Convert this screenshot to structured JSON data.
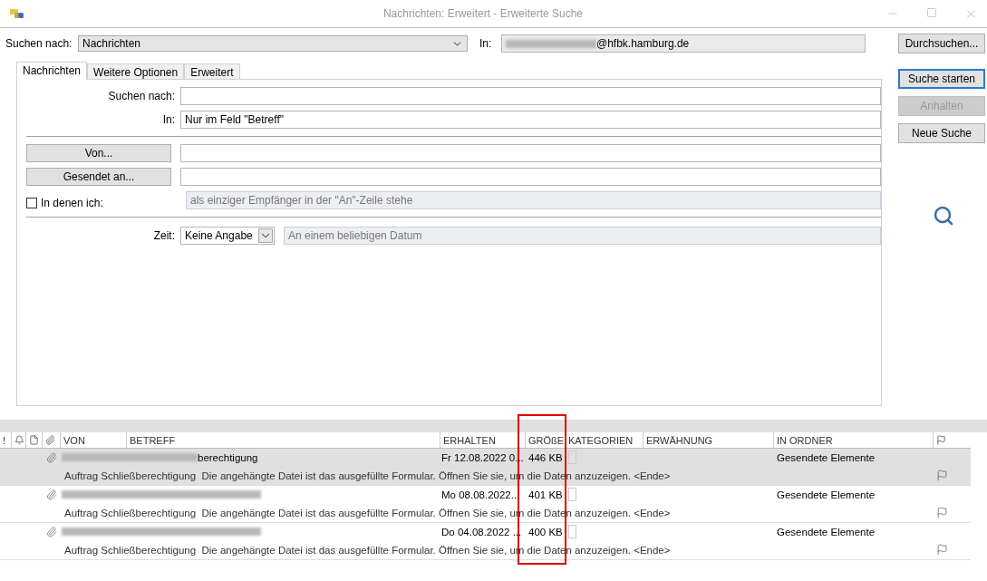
{
  "window": {
    "title": "Nachrichten: Erweitert - Erweiterte Suche"
  },
  "search_for": {
    "label": "Suchen nach:",
    "value": "Nachrichten"
  },
  "location": {
    "label": "In:",
    "value": "@hfbk.hamburg.de"
  },
  "tabs": [
    {
      "label": "Nachrichten",
      "selected": true
    },
    {
      "label": "Weitere Optionen",
      "selected": false
    },
    {
      "label": "Erweitert",
      "selected": false
    }
  ],
  "form": [
    {
      "kind": "text",
      "label": "Suchen nach:"
    },
    {
      "kind": "text",
      "label": "In:",
      "value": "Nur im Feld \"Betreff\""
    },
    {
      "kind": "rule"
    },
    {
      "kind": "button-field",
      "button": "Von..."
    },
    {
      "kind": "button-field",
      "button": "Gesendet an..."
    },
    {
      "kind": "checkbox-field",
      "label": "In denen ich:",
      "checked": false,
      "value": "als einziger Empfänger in der \"An\"-Zeile stehe",
      "disabled": true
    },
    {
      "kind": "rule"
    },
    {
      "kind": "time",
      "label": "Zeit:",
      "value": "Keine Angabe",
      "date": "An einem beliebigen Datum",
      "disabled": true
    }
  ],
  "buttons": [
    {
      "label": "Durchsuchen...",
      "default": false,
      "disabled": false
    },
    {
      "label": "Suche starten",
      "default": true,
      "disabled": false
    },
    {
      "label": "Anhalten",
      "default": false,
      "disabled": true
    },
    {
      "label": "Neue Suche",
      "default": false,
      "disabled": false
    }
  ],
  "table": {
    "columns": [
      {
        "kind": "text",
        "label": "!",
        "highlighted": false
      },
      {
        "kind": "reminder",
        "highlighted": false
      },
      {
        "kind": "type",
        "highlighted": false
      },
      {
        "kind": "attachment",
        "highlighted": false
      },
      {
        "kind": "text",
        "label": "VON",
        "highlighted": false
      },
      {
        "kind": "text",
        "label": "BETREFF",
        "highlighted": false
      },
      {
        "kind": "text",
        "label": "ERHALTEN",
        "highlighted": false
      },
      {
        "kind": "text",
        "label": "GRÖßE",
        "highlighted": true
      },
      {
        "kind": "text",
        "label": "KATEGORIEN",
        "highlighted": false
      },
      {
        "kind": "text",
        "label": "ERWÄHNUNG",
        "highlighted": false
      },
      {
        "kind": "text",
        "label": "IN ORDNER",
        "highlighted": false
      },
      {
        "kind": "flag",
        "highlighted": false
      }
    ],
    "rows": [
      {
        "selected": true,
        "attachment": true,
        "subject": "berechtigung",
        "received": "Fr 12.08.2022 0...",
        "size": "446 KB",
        "folder": "Gesendete Elemente",
        "preview": "Auftrag Schließberechtigung  Die angehängte Datei ist das ausgefüllte Formular. Öffnen Sie sie, um die Daten anzuzeigen. <Ende>"
      },
      {
        "selected": false,
        "attachment": true,
        "received": "Mo 08.08.2022...",
        "size": "401 KB",
        "folder": "Gesendete Elemente",
        "preview": "Auftrag Schließberechtigung  Die angehängte Datei ist das ausgefüllte Formular. Öffnen Sie sie, um die Daten anzuzeigen. <Ende>"
      },
      {
        "selected": false,
        "attachment": true,
        "received": "Do 04.08.2022 ...",
        "size": "400 KB",
        "folder": "Gesendete Elemente",
        "preview": "Auftrag Schließberechtigung  Die angehängte Datei ist das ausgefüllte Formular. Öffnen Sie sie, um die Daten anzuzeigen. <Ende>"
      }
    ]
  }
}
